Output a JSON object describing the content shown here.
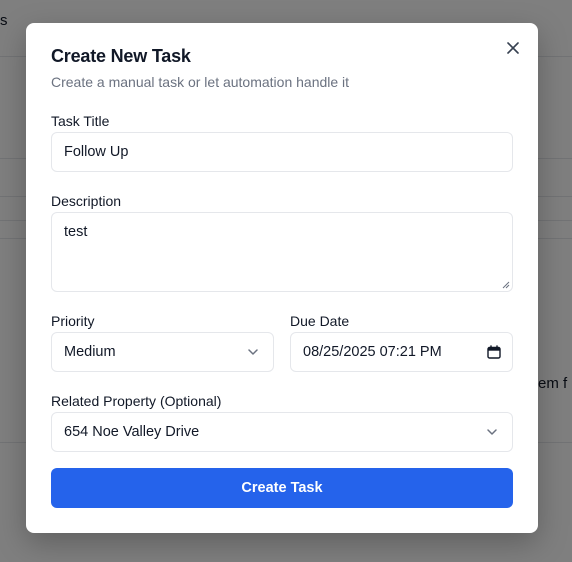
{
  "background": {
    "fragment_top": "s",
    "fragment_right": "em f"
  },
  "modal": {
    "title": "Create New Task",
    "subtitle": "Create a manual task or let automation handle it",
    "fields": {
      "task_title": {
        "label": "Task Title",
        "value": "Follow Up"
      },
      "description": {
        "label": "Description",
        "value": "test"
      },
      "priority": {
        "label": "Priority",
        "value": "Medium"
      },
      "due_date": {
        "label": "Due Date",
        "value": "08/25/2025 07:21 PM"
      },
      "related_property": {
        "label": "Related Property (Optional)",
        "value": "654 Noe Valley Drive"
      }
    },
    "submit_label": "Create Task"
  },
  "colors": {
    "accent": "#2563eb",
    "overlay": "rgba(0,0,0,0.5)",
    "subtitle": "#6b7280",
    "border": "#e5e7eb"
  },
  "icons": {
    "close": "close-icon",
    "priority_dropdown": "chevron-down-icon",
    "property_dropdown": "chevron-down-icon",
    "due_date": "calendar-icon"
  }
}
